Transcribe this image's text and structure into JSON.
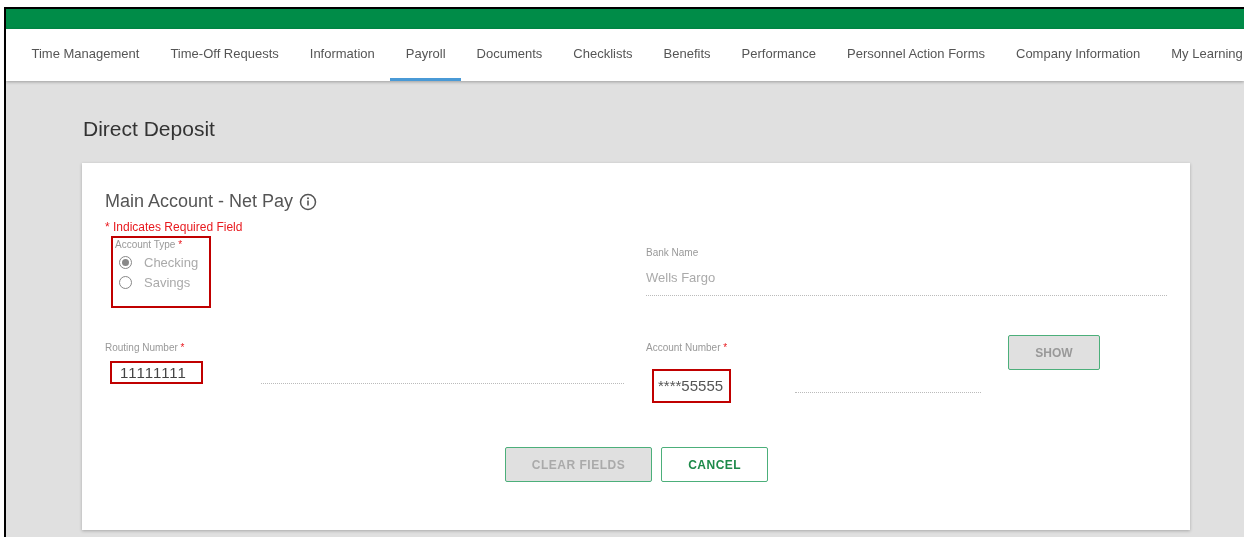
{
  "tabs": [
    {
      "label": "Time Management",
      "selected": false
    },
    {
      "label": "Time-Off Requests",
      "selected": false
    },
    {
      "label": "Information",
      "selected": false
    },
    {
      "label": "Payroll",
      "selected": true
    },
    {
      "label": "Documents",
      "selected": false
    },
    {
      "label": "Checklists",
      "selected": false
    },
    {
      "label": "Benefits",
      "selected": false
    },
    {
      "label": "Performance",
      "selected": false
    },
    {
      "label": "Personnel Action Forms",
      "selected": false
    },
    {
      "label": "Company Information",
      "selected": false
    },
    {
      "label": "My Learning",
      "selected": false
    }
  ],
  "page_title": "Direct Deposit",
  "card": {
    "title": "Main Account - Net Pay",
    "required_note": "* Indicates Required Field",
    "account_type": {
      "label": "Account Type",
      "required_mark": "*",
      "highlighted": true,
      "options": [
        {
          "label": "Checking",
          "selected": true
        },
        {
          "label": "Savings",
          "selected": false
        }
      ]
    },
    "bank_name": {
      "label": "Bank Name",
      "value": "Wells Fargo"
    },
    "routing_number": {
      "label": "Routing Number",
      "required_mark": "*",
      "value": "11111111",
      "highlighted": true
    },
    "account_number": {
      "label": "Account Number",
      "required_mark": "*",
      "value": "****55555",
      "highlighted": true
    },
    "show_button": "SHOW",
    "buttons": [
      {
        "label": "CLEAR FIELDS",
        "disabled": true
      },
      {
        "label": "CANCEL",
        "disabled": false
      }
    ]
  }
}
